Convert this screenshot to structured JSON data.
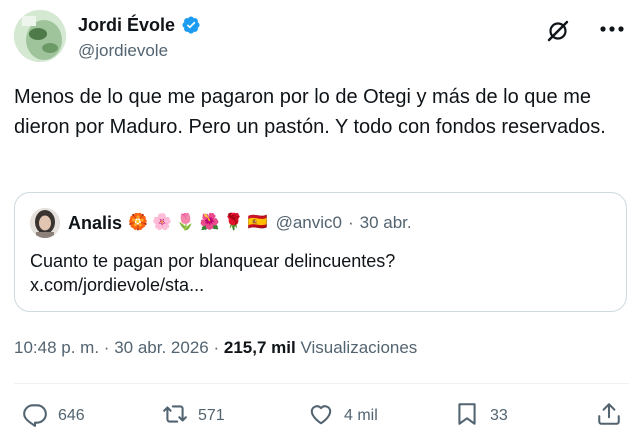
{
  "author": {
    "name": "Jordi Évole",
    "handle": "@jordievole"
  },
  "tweet": {
    "text": "Menos de lo que me pagaron por lo de Otegi y más de lo que me dieron por Maduro. Pero un pastón. Y todo con fondos reservados."
  },
  "quote": {
    "name": "Analis",
    "emojis": [
      "🏵️",
      "🌸",
      "🌷",
      "🌺",
      "🌹",
      "🇪🇸"
    ],
    "handle": "@anvic0",
    "separator": "·",
    "date": "30 abr.",
    "text_line1": "Cuanto te pagan por blanquear delincuentes?",
    "text_line2": "x.com/jordievole/sta..."
  },
  "meta": {
    "time": "10:48 p. m.",
    "separator": "·",
    "date": "30 abr. 2026",
    "separator2": "·",
    "views_count": "215,7 mil",
    "views_label": "Visualizaciones"
  },
  "actions": {
    "replies": "646",
    "reposts": "571",
    "likes": "4 mil",
    "bookmarks": "33"
  },
  "colors": {
    "verified": "#1d9bf0",
    "secondary_text": "#536471",
    "border": "#cfd9de"
  },
  "icons": {
    "verified": "verified-badge-icon",
    "grok": "grok-icon",
    "more": "more-icon",
    "reply": "reply-icon",
    "repost": "repost-icon",
    "like": "heart-icon",
    "bookmark": "bookmark-icon",
    "share": "share-icon"
  }
}
